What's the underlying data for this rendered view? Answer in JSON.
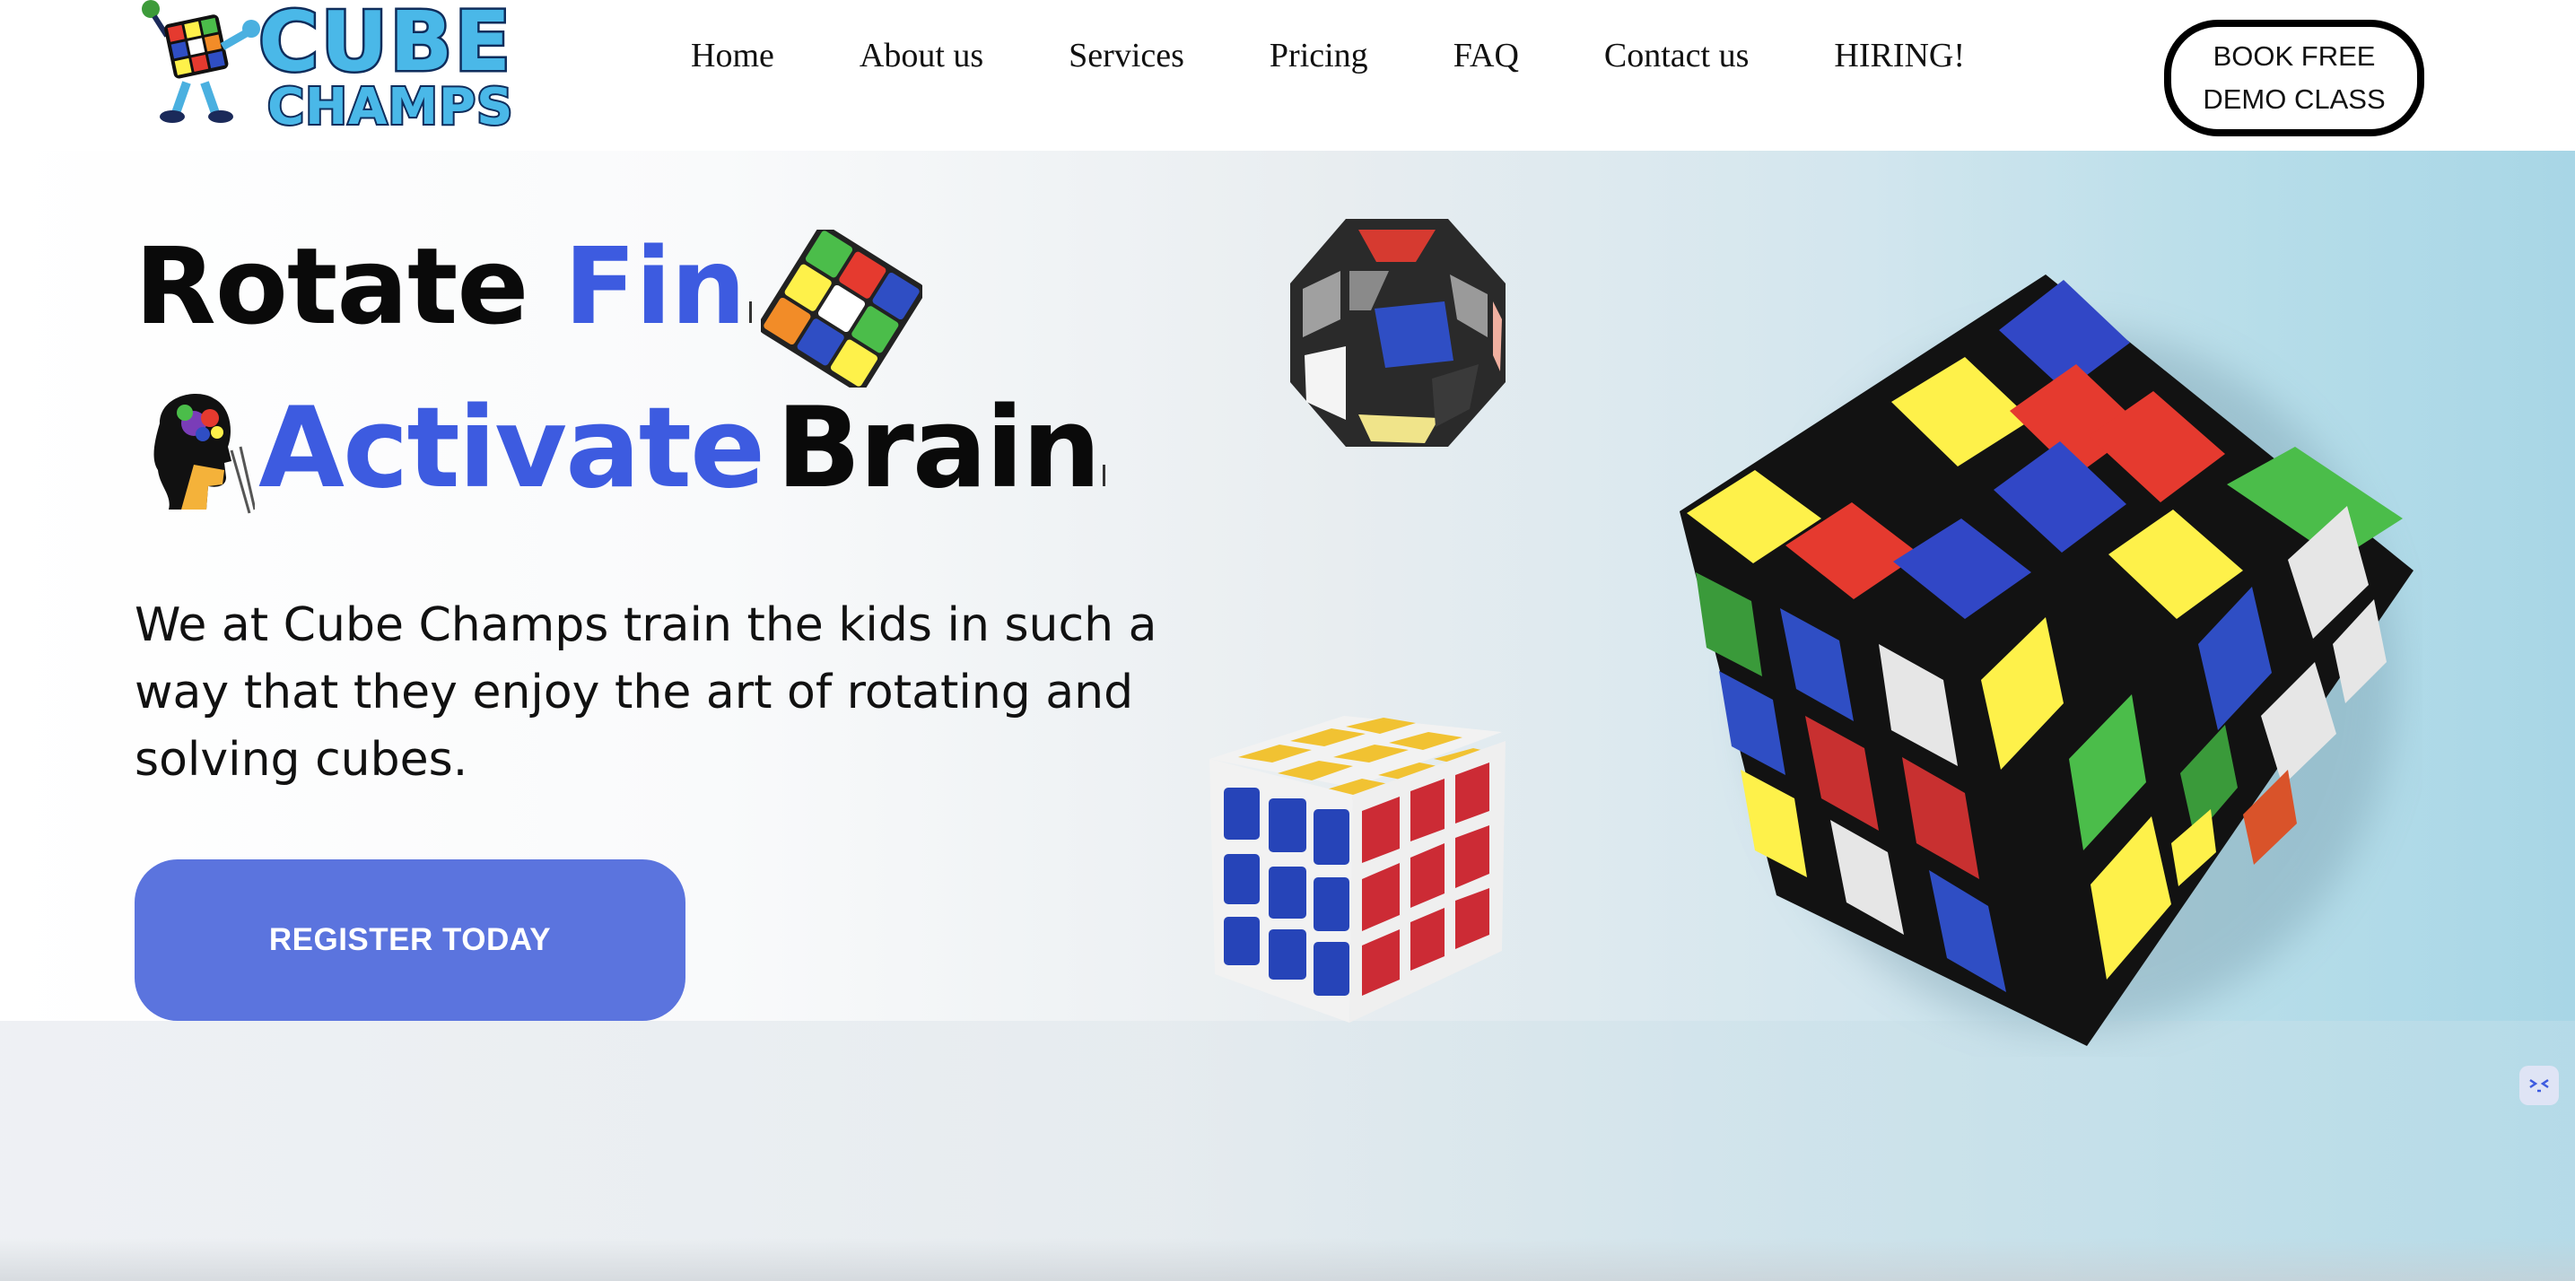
{
  "brand": {
    "line1": "CUBE",
    "line2": "CHAMPS"
  },
  "nav": {
    "items": [
      {
        "label": "Home"
      },
      {
        "label": "About us"
      },
      {
        "label": "Services"
      },
      {
        "label": "Pricing"
      },
      {
        "label": "FAQ"
      },
      {
        "label": "Contact us"
      },
      {
        "label": "HIRING!"
      }
    ],
    "cta_line1": "BOOK FREE",
    "cta_line2": "DEMO CLASS"
  },
  "hero": {
    "headline_word1": "Rotate",
    "headline_word1_typed": "Fin",
    "headline_word2_typed": "Activate",
    "headline_word2": "Brain",
    "description": "We at Cube Champs train the kids in such a way that they enjoy the art of rotating and solving cubes.",
    "register_label": "REGISTER TODAY"
  },
  "colors": {
    "accent_blue": "#3d5be0",
    "button_blue": "#5b74de",
    "cube_red": "#e53a2f",
    "cube_blue": "#2f4ec4",
    "cube_yellow": "#fef14a",
    "cube_green": "#4bbd4a",
    "cube_white": "#e6e6e6"
  },
  "icons": {
    "logo": "cube-mascot-logo",
    "small_cube": "rubiks-cube-icon",
    "brain_head": "brain-head-icon",
    "floating": "chat-widget-icon"
  }
}
